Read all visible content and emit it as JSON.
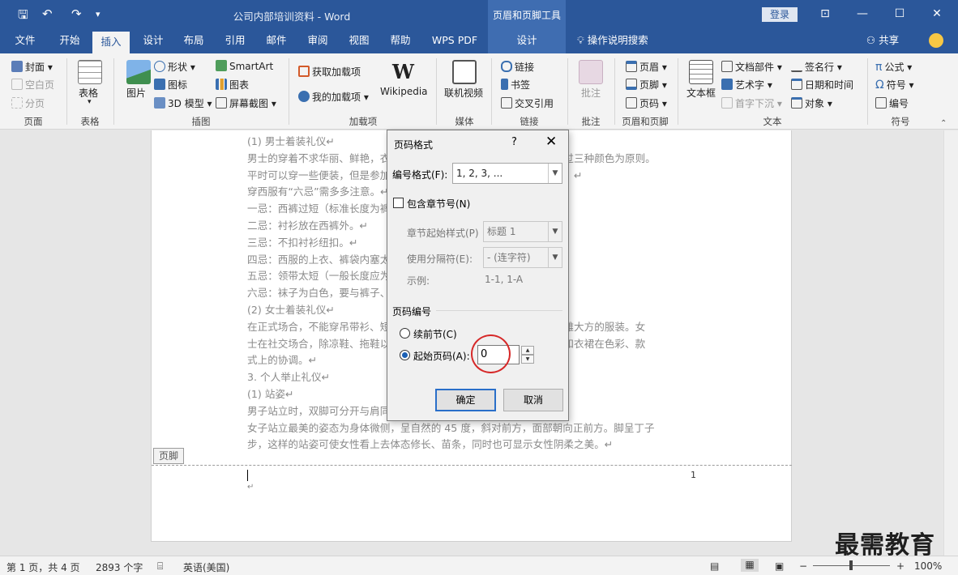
{
  "title_bar": {
    "doc_title": "公司内部培训资料  -  Word",
    "context_group": "页眉和页脚工具",
    "login": "登录",
    "quick_access": {
      "save": "🖫",
      "undo": "↶",
      "redo": "↷",
      "customize": "▾"
    },
    "window_buttons": {
      "restore_ribbon": "⊡",
      "minimize": "—",
      "maximize": "☐",
      "close": "✕"
    }
  },
  "tabs": [
    "文件",
    "开始",
    "插入",
    "设计",
    "布局",
    "引用",
    "邮件",
    "审阅",
    "视图",
    "帮助",
    "WPS PDF",
    "设计"
  ],
  "active_tab": "插入",
  "tell_me": "操作说明搜索",
  "share": "共享",
  "ribbon": {
    "pages": {
      "cover": "封面",
      "blank": "空白页",
      "break": "分页",
      "label": "页面"
    },
    "tables": {
      "table": "表格",
      "label": "表格"
    },
    "illustrations": {
      "picture": "图片",
      "shapes": "形状",
      "icons": "图标",
      "model3d": "3D 模型",
      "smartart": "SmartArt",
      "chart": "图表",
      "screenshot": "屏幕截图",
      "label": "插图"
    },
    "addins": {
      "get": "获取加载项",
      "my": "我的加载项",
      "wikipedia": "Wikipedia",
      "label": "加载项"
    },
    "media": {
      "video": "联机视频",
      "label": "媒体"
    },
    "links": {
      "link": "链接",
      "bookmark": "书签",
      "xref": "交叉引用",
      "label": "链接"
    },
    "comments": {
      "comment": "批注",
      "label": "批注"
    },
    "header_footer": {
      "header": "页眉",
      "footer": "页脚",
      "page_number": "页码",
      "label": "页眉和页脚"
    },
    "text": {
      "textbox": "文本框",
      "quickparts": "文档部件",
      "wordart": "艺术字",
      "dropcap": "首字下沉",
      "signature": "签名行",
      "datetime": "日期和时间",
      "object": "对象",
      "label": "文本"
    },
    "symbols": {
      "equation": "公式",
      "symbol": "符号",
      "number": "编号",
      "label": "符号"
    }
  },
  "document": {
    "lines": [
      "(1) 男士着装礼仪↵",
      "男士的穿着不求华丽、鲜艳，衣着不宜有过多的色彩变化，大致以不超过三种颜色为原则。",
      "平时可以穿一些便装，但是参加正式、隆重的场合，则应穿礼服或西服。↵",
      "穿西服有“六忌”需多多注意。↵",
      "一忌：西裤过短（标准长度为裤长盖住皮鞋）。↵",
      "二忌：衬衫放在西裤外。↵",
      "三忌：不扣衬衫纽扣。↵",
      "四忌：西服的上衣、裤袋内塞太多东西。↵",
      "五忌：领带太短（一般长度应为领带尖盖住皮带扣）。↵",
      "六忌：袜子为白色，要与裤子、鞋同类颜色或较深的色调。↵",
      "(2) 女士着装礼仪↵",
      "在正式场合，不能穿吊带衫、短裤、超短裙等过于暴露的服装，应穿典雅大方的服装。女",
      "士在社交场合，除凉鞋、拖鞋以外的鞋子，都要穿袜子，同时注意鞋子和衣裙在色彩、款",
      "式上的协调。↵",
      "3. 个人举止礼仪↵",
      "(1) 站姿↵",
      "男子站立时，双脚可分开与肩同宽，双手自然下垂或交叉于体前。↵",
      "女子站立最美的姿态为身体微侧，呈自然的 45 度，斜对前方，面部朝向正前方。脚呈丁子",
      "步，这样的站姿可使女性看上去体态修长、苗条，同时也可显示女性阴柔之美。↵"
    ],
    "footer_tag": "页脚",
    "page_number": "1",
    "para_mark": "↵"
  },
  "dialog": {
    "title": "页码格式",
    "help": "?",
    "close": "✕",
    "number_format_label": "编号格式(F):",
    "number_format_value": "1, 2, 3, ...",
    "include_chapter_label": "包含章节号(N)",
    "include_chapter_checked": false,
    "chapter_style_label": "章节起始样式(P)",
    "chapter_style_value": "标题 1",
    "separator_label": "使用分隔符(E):",
    "separator_value": "-   (连字符)",
    "example_label": "示例:",
    "example_value": "1-1, 1-A",
    "numbering_section": "页码编号",
    "continue_label": "续前节(C)",
    "start_at_label": "起始页码(A):",
    "start_at_value": "0",
    "selected_option": "start_at",
    "ok": "确定",
    "cancel": "取消"
  },
  "watermark": "最需教育",
  "status_bar": {
    "page": "第 1 页，共 4 页",
    "words": "2893 个字",
    "language": "英语(美国)",
    "zoom": "100%",
    "zoom_minus": "−",
    "zoom_plus": "+"
  },
  "colors": {
    "brand": "#2b579a",
    "context": "#3f6db1",
    "annotation": "#d62828"
  }
}
